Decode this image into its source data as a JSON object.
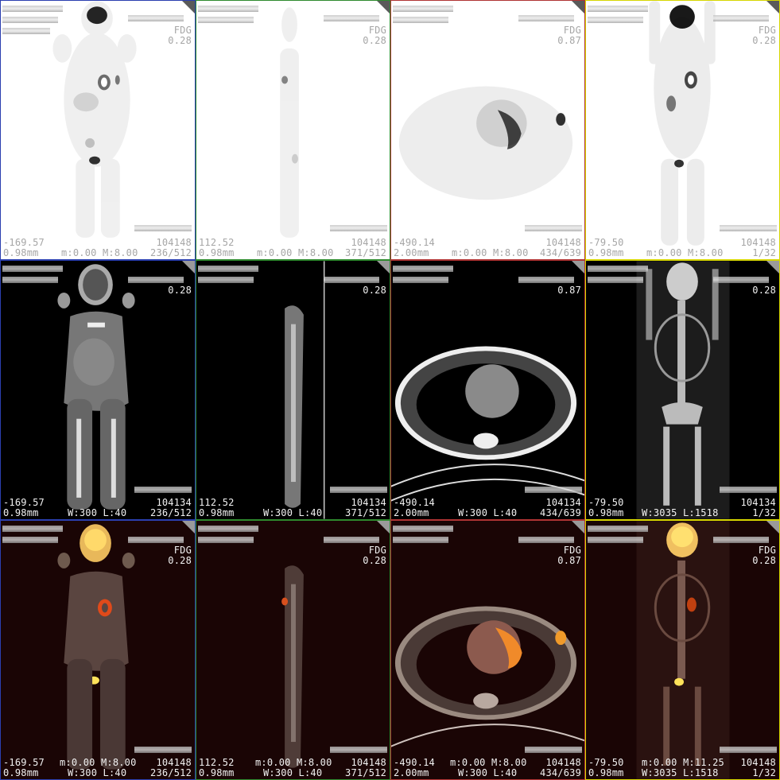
{
  "app": {
    "layout": "3x4 PET/CT hanging protocol",
    "rows": [
      "PET",
      "CT",
      "Fusion"
    ]
  },
  "overlays": {
    "pet_coronal": {
      "tracer": "FDG",
      "value": "0.28",
      "pos": "-169.57",
      "spacing": "0.98mm",
      "window": "m:0.00 M:8.00",
      "series": "104148",
      "slice": "236/512"
    },
    "pet_sagittal": {
      "tracer": "FDG",
      "value": "0.28",
      "pos": "112.52",
      "spacing": "0.98mm",
      "window": "m:0.00 M:8.00",
      "series": "104148",
      "slice": "371/512"
    },
    "pet_axial": {
      "tracer": "FDG",
      "value": "0.87",
      "pos": "-490.14",
      "spacing": "2.00mm",
      "window": "m:0.00 M:8.00",
      "series": "104148",
      "slice": "434/639"
    },
    "pet_mip": {
      "tracer": "FDG",
      "value": "0.28",
      "pos": "-79.50",
      "spacing": "0.98mm",
      "window": "m:0.00 M:8.00",
      "series": "104148",
      "slice": "1/32"
    },
    "ct_coronal": {
      "value": "0.28",
      "pos": "-169.57",
      "spacing": "0.98mm",
      "window": "W:300 L:40",
      "series": "104134",
      "slice": "236/512"
    },
    "ct_sagittal": {
      "value": "0.28",
      "pos": "112.52",
      "spacing": "0.98mm",
      "window": "W:300 L:40",
      "series": "104134",
      "slice": "371/512"
    },
    "ct_axial": {
      "value": "0.87",
      "pos": "-490.14",
      "spacing": "2.00mm",
      "window": "W:300 L:40",
      "series": "104134",
      "slice": "434/639"
    },
    "ct_mip": {
      "value": "0.28",
      "pos": "-79.50",
      "spacing": "0.98mm",
      "window": "W:3035 L:1518",
      "series": "104134",
      "slice": "1/32"
    },
    "fusion_coronal": {
      "tracer": "FDG",
      "value": "0.28",
      "pos": "-169.57",
      "spacing": "0.98mm",
      "window_pet": "m:0.00 M:8.00",
      "window_ct": "W:300 L:40",
      "series": "104148",
      "slice": "236/512"
    },
    "fusion_sagittal": {
      "tracer": "FDG",
      "value": "0.28",
      "pos": "112.52",
      "spacing": "0.98mm",
      "window_pet": "m:0.00 M:8.00",
      "window_ct": "W:300 L:40",
      "series": "104148",
      "slice": "371/512"
    },
    "fusion_axial": {
      "tracer": "FDG",
      "value": "0.87",
      "pos": "-490.14",
      "spacing": "2.00mm",
      "window_pet": "m:0.00 M:8.00",
      "window_ct": "W:300 L:40",
      "series": "104148",
      "slice": "434/639"
    },
    "fusion_mip": {
      "tracer": "FDG",
      "value": "0.28",
      "pos": "-79.50",
      "spacing": "0.98mm",
      "window_pet": "m:0.00 M:11.25",
      "window_ct": "W:3035 L:1518",
      "series": "104148",
      "slice": "1/32"
    }
  },
  "colors": {
    "blue": "#2b3fb0",
    "green": "#2e8a2e",
    "red": "#b03434",
    "yellow": "#d6d600"
  }
}
